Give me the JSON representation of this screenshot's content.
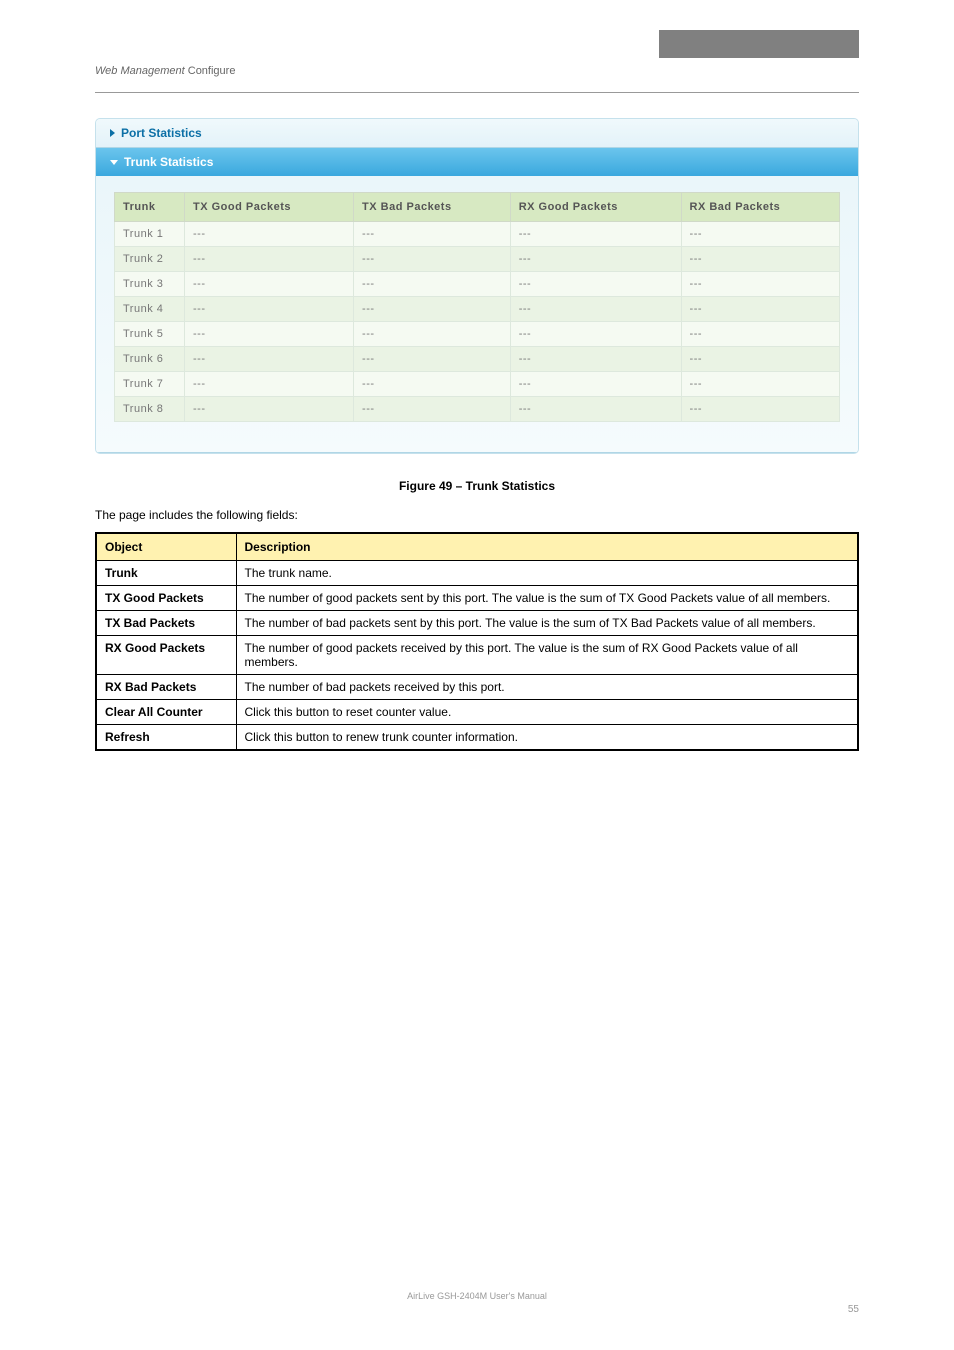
{
  "header": {
    "chapter_prefix": "Web Management",
    "chapter_title": "Configure"
  },
  "panel": {
    "section1_title": "Port Statistics",
    "section2_title": "Trunk Statistics"
  },
  "ui_table": {
    "headers": [
      "Trunk",
      "TX Good Packets",
      "TX Bad Packets",
      "RX Good Packets",
      "RX Bad Packets"
    ],
    "rows": [
      {
        "trunk": "Trunk 1",
        "tx_good": "---",
        "tx_bad": "---",
        "rx_good": "---",
        "rx_bad": "---"
      },
      {
        "trunk": "Trunk 2",
        "tx_good": "---",
        "tx_bad": "---",
        "rx_good": "---",
        "rx_bad": "---"
      },
      {
        "trunk": "Trunk 3",
        "tx_good": "---",
        "tx_bad": "---",
        "rx_good": "---",
        "rx_bad": "---"
      },
      {
        "trunk": "Trunk 4",
        "tx_good": "---",
        "tx_bad": "---",
        "rx_good": "---",
        "rx_bad": "---"
      },
      {
        "trunk": "Trunk 5",
        "tx_good": "---",
        "tx_bad": "---",
        "rx_good": "---",
        "rx_bad": "---"
      },
      {
        "trunk": "Trunk 6",
        "tx_good": "---",
        "tx_bad": "---",
        "rx_good": "---",
        "rx_bad": "---"
      },
      {
        "trunk": "Trunk 7",
        "tx_good": "---",
        "tx_bad": "---",
        "rx_good": "---",
        "rx_bad": "---"
      },
      {
        "trunk": "Trunk 8",
        "tx_good": "---",
        "tx_bad": "---",
        "rx_good": "---",
        "rx_bad": "---"
      }
    ]
  },
  "caption": "Figure 49 – Trunk Statistics",
  "intro": "The page includes the following fields:",
  "object_table": {
    "headers": [
      "Object",
      "Description"
    ],
    "rows": [
      {
        "object": "Trunk",
        "desc": "The trunk name."
      },
      {
        "object": "TX Good Packets",
        "desc": "The number of good packets sent by this port. The value is the sum of TX Good Packets value of all members."
      },
      {
        "object": "TX Bad Packets",
        "desc": "The number of bad packets sent by this port. The value is the sum of TX Bad Packets value of all members."
      },
      {
        "object": "RX Good Packets",
        "desc": "The number of good packets received by this port. The value is the sum of RX Good Packets value of all members."
      },
      {
        "object": "RX Bad Packets",
        "desc": "The number of bad packets received by this port."
      },
      {
        "object": "Clear All Counter",
        "desc": "Click this button to reset counter value."
      },
      {
        "object": "Refresh",
        "desc": "Click this button to renew trunk counter information."
      }
    ]
  },
  "footer": {
    "text": "AirLive GSH-2404M User's Manual",
    "page": "55"
  }
}
